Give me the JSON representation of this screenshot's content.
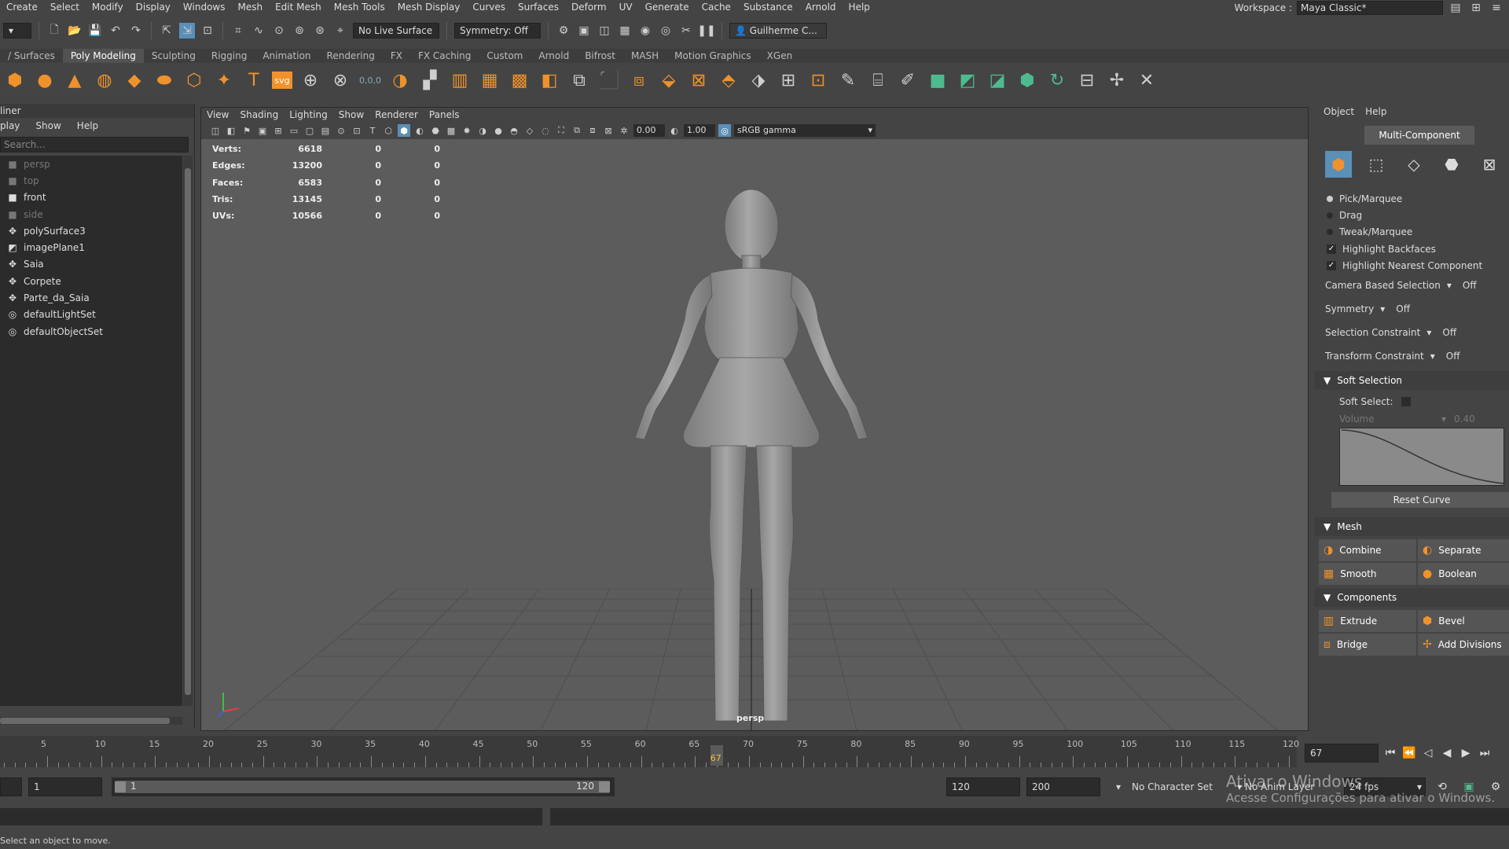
{
  "menubar": {
    "items": [
      "Create",
      "Select",
      "Modify",
      "Display",
      "Windows",
      "Mesh",
      "Edit Mesh",
      "Mesh Tools",
      "Mesh Display",
      "Curves",
      "Surfaces",
      "Deform",
      "UV",
      "Generate",
      "Cache",
      "Substance",
      "Arnold",
      "Help"
    ],
    "workspace_label": "Workspace :",
    "workspace_value": "Maya Classic*"
  },
  "statusline": {
    "live_surface": "No Live Surface",
    "symmetry": "Symmetry: Off",
    "user": "Guilherme C..."
  },
  "shelf": {
    "tabs": [
      " / Surfaces",
      "Poly Modeling",
      "Sculpting",
      "Rigging",
      "Animation",
      "Rendering",
      "FX",
      "FX Caching",
      "Custom",
      "Arnold",
      "Bifrost",
      "MASH",
      "Motion Graphics",
      "XGen"
    ],
    "active_tab": "Poly Modeling",
    "svg_label": "svg",
    "value_label": "0,0,0"
  },
  "outliner": {
    "title": "liner",
    "menu": [
      "play",
      "Show",
      "Help"
    ],
    "search_placeholder": "Search...",
    "items": [
      {
        "label": "persp",
        "icon": "camera-icon",
        "dim": true
      },
      {
        "label": "top",
        "icon": "camera-icon",
        "dim": true
      },
      {
        "label": "front",
        "icon": "camera-icon",
        "dim": false
      },
      {
        "label": "side",
        "icon": "camera-icon",
        "dim": true
      },
      {
        "label": "polySurface3",
        "icon": "mesh-icon",
        "dim": false
      },
      {
        "label": "imagePlane1",
        "icon": "image-plane-icon",
        "dim": false
      },
      {
        "label": "Saia",
        "icon": "mesh-icon",
        "dim": false
      },
      {
        "label": "Corpete",
        "icon": "mesh-icon",
        "dim": false
      },
      {
        "label": "Parte_da_Saia",
        "icon": "mesh-icon",
        "dim": false
      },
      {
        "label": "defaultLightSet",
        "icon": "set-icon",
        "dim": false
      },
      {
        "label": "defaultObjectSet",
        "icon": "set-icon",
        "dim": false
      }
    ]
  },
  "viewport": {
    "menu": [
      "View",
      "Shading",
      "Lighting",
      "Show",
      "Renderer",
      "Panels"
    ],
    "exposure": "0.00",
    "gamma": "1.00",
    "color_space": "sRGB gamma",
    "camera": "persp",
    "hud": [
      {
        "label": "Verts:",
        "total": "6618",
        "sel1": "0",
        "sel2": "0"
      },
      {
        "label": "Edges:",
        "total": "13200",
        "sel1": "0",
        "sel2": "0"
      },
      {
        "label": "Faces:",
        "total": "6583",
        "sel1": "0",
        "sel2": "0"
      },
      {
        "label": "Tris:",
        "total": "13145",
        "sel1": "0",
        "sel2": "0"
      },
      {
        "label": "UVs:",
        "total": "10566",
        "sel1": "0",
        "sel2": "0"
      }
    ]
  },
  "toolkit": {
    "menu": [
      "Object",
      "Help"
    ],
    "mode_button": "Multi-Component",
    "radio": [
      {
        "label": "Pick/Marquee",
        "on": true
      },
      {
        "label": "Drag",
        "on": false
      },
      {
        "label": "Tweak/Marquee",
        "on": false
      }
    ],
    "checks": [
      {
        "label": "Highlight Backfaces",
        "checked": true
      },
      {
        "label": "Highlight Nearest Component",
        "checked": true
      }
    ],
    "options": [
      {
        "label": "Camera Based Selection",
        "value": "Off"
      },
      {
        "label": "Symmetry",
        "value": "Off"
      },
      {
        "label": "Selection Constraint",
        "value": "Off"
      },
      {
        "label": "Transform Constraint",
        "value": "Off"
      }
    ],
    "soft_selection": {
      "title": "Soft Selection",
      "soft_select_label": "Soft Select:",
      "volume_label": "Volume",
      "volume_value": "0.40",
      "reset_curve": "Reset Curve"
    },
    "mesh": {
      "title": "Mesh",
      "buttons": [
        "Combine",
        "Separate",
        "Smooth",
        "Boolean"
      ]
    },
    "components": {
      "title": "Components",
      "buttons": [
        "Extrude",
        "Bevel",
        "Bridge",
        "Add Divisions"
      ]
    }
  },
  "timeslider": {
    "labels": [
      "5",
      "10",
      "15",
      "20",
      "25",
      "30",
      "35",
      "40",
      "45",
      "50",
      "55",
      "60",
      "65",
      "70",
      "75",
      "80",
      "85",
      "90",
      "95",
      "100",
      "105",
      "110",
      "115",
      "120"
    ],
    "current_frame": "67",
    "current_frame_field": "67"
  },
  "rangeslider": {
    "start_field": "1",
    "range_start": "1",
    "range_end": "120",
    "end_field": "120",
    "end_field2": "200",
    "character_set": "No Character Set",
    "anim_layer": "No Anim Layer",
    "fps": "24 fps"
  },
  "helpline": {
    "text": "Select an object to move."
  },
  "watermark": {
    "line1": "Ativar o Windows",
    "line2": "Acesse Configurações para ativar o Windows."
  }
}
